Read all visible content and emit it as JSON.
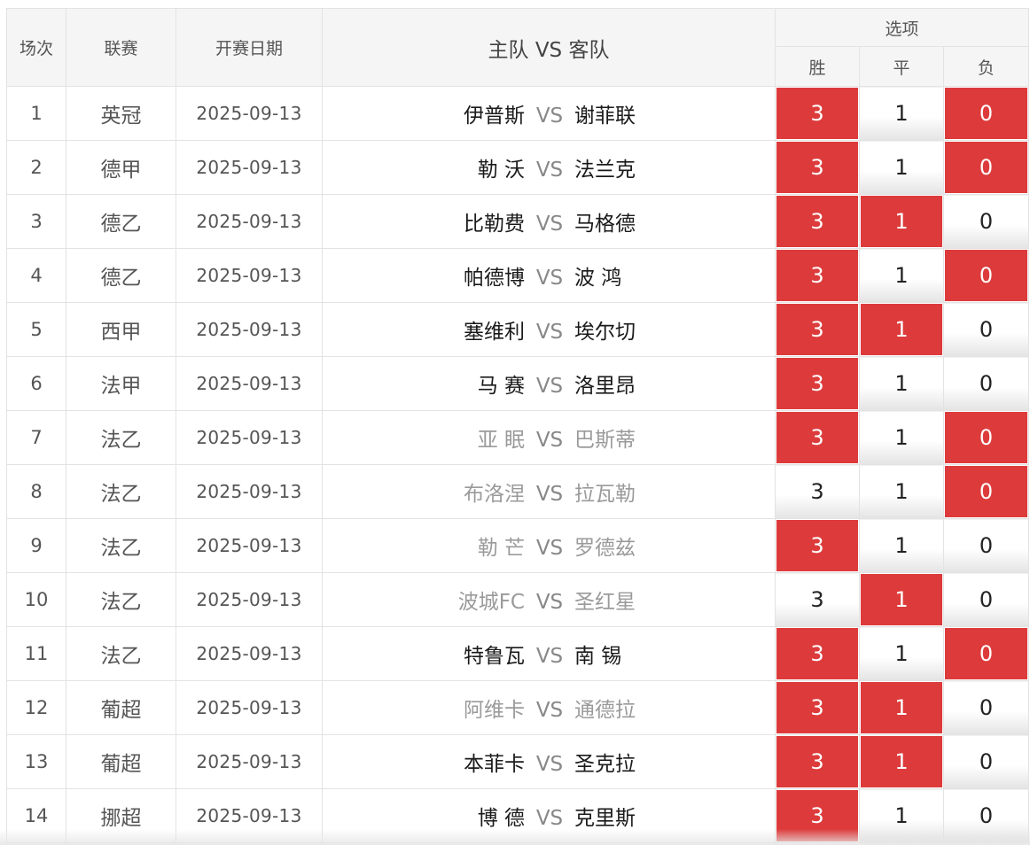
{
  "headers": {
    "num": "场次",
    "league": "联赛",
    "date": "开赛日期",
    "match": "主队 VS 客队",
    "options_group": "选项",
    "win": "胜",
    "draw": "平",
    "lose": "负"
  },
  "colors": {
    "selected": "#dd3b3b",
    "muted_team": "#9a9a9a",
    "dark_team": "#1a1a1a"
  },
  "rows": [
    {
      "num": "1",
      "league": "英冠",
      "date": "2025-09-13",
      "home": "伊普斯",
      "vs": "VS",
      "away": "谢菲联",
      "home_muted": false,
      "away_muted": false,
      "w": "3",
      "d": "1",
      "l": "0",
      "w_on": true,
      "d_on": false,
      "l_on": true
    },
    {
      "num": "2",
      "league": "德甲",
      "date": "2025-09-13",
      "home": "勒 沃",
      "vs": "VS",
      "away": "法兰克",
      "home_muted": false,
      "away_muted": false,
      "w": "3",
      "d": "1",
      "l": "0",
      "w_on": true,
      "d_on": false,
      "l_on": true
    },
    {
      "num": "3",
      "league": "德乙",
      "date": "2025-09-13",
      "home": "比勒费",
      "vs": "VS",
      "away": "马格德",
      "home_muted": false,
      "away_muted": false,
      "w": "3",
      "d": "1",
      "l": "0",
      "w_on": true,
      "d_on": true,
      "l_on": false
    },
    {
      "num": "4",
      "league": "德乙",
      "date": "2025-09-13",
      "home": "帕德博",
      "vs": "VS",
      "away": "波 鸿",
      "home_muted": false,
      "away_muted": false,
      "w": "3",
      "d": "1",
      "l": "0",
      "w_on": true,
      "d_on": false,
      "l_on": true
    },
    {
      "num": "5",
      "league": "西甲",
      "date": "2025-09-13",
      "home": "塞维利",
      "vs": "VS",
      "away": "埃尔切",
      "home_muted": false,
      "away_muted": false,
      "w": "3",
      "d": "1",
      "l": "0",
      "w_on": true,
      "d_on": true,
      "l_on": false
    },
    {
      "num": "6",
      "league": "法甲",
      "date": "2025-09-13",
      "home": "马 赛",
      "vs": "VS",
      "away": "洛里昂",
      "home_muted": false,
      "away_muted": false,
      "w": "3",
      "d": "1",
      "l": "0",
      "w_on": true,
      "d_on": false,
      "l_on": false
    },
    {
      "num": "7",
      "league": "法乙",
      "date": "2025-09-13",
      "home": "亚 眠",
      "vs": "VS",
      "away": "巴斯蒂",
      "home_muted": true,
      "away_muted": true,
      "w": "3",
      "d": "1",
      "l": "0",
      "w_on": true,
      "d_on": false,
      "l_on": true
    },
    {
      "num": "8",
      "league": "法乙",
      "date": "2025-09-13",
      "home": "布洛涅",
      "vs": "VS",
      "away": "拉瓦勒",
      "home_muted": true,
      "away_muted": true,
      "w": "3",
      "d": "1",
      "l": "0",
      "w_on": false,
      "d_on": false,
      "l_on": true
    },
    {
      "num": "9",
      "league": "法乙",
      "date": "2025-09-13",
      "home": "勒 芒",
      "vs": "VS",
      "away": "罗德兹",
      "home_muted": true,
      "away_muted": true,
      "w": "3",
      "d": "1",
      "l": "0",
      "w_on": true,
      "d_on": false,
      "l_on": false
    },
    {
      "num": "10",
      "league": "法乙",
      "date": "2025-09-13",
      "home": "波城FC",
      "vs": "VS",
      "away": "圣红星",
      "home_muted": true,
      "away_muted": true,
      "w": "3",
      "d": "1",
      "l": "0",
      "w_on": false,
      "d_on": true,
      "l_on": false
    },
    {
      "num": "11",
      "league": "法乙",
      "date": "2025-09-13",
      "home": "特鲁瓦",
      "vs": "VS",
      "away": "南 锡",
      "home_muted": false,
      "away_muted": false,
      "w": "3",
      "d": "1",
      "l": "0",
      "w_on": true,
      "d_on": false,
      "l_on": true
    },
    {
      "num": "12",
      "league": "葡超",
      "date": "2025-09-13",
      "home": "阿维卡",
      "vs": "VS",
      "away": "通德拉",
      "home_muted": true,
      "away_muted": true,
      "w": "3",
      "d": "1",
      "l": "0",
      "w_on": true,
      "d_on": true,
      "l_on": false
    },
    {
      "num": "13",
      "league": "葡超",
      "date": "2025-09-13",
      "home": "本菲卡",
      "vs": "VS",
      "away": "圣克拉",
      "home_muted": false,
      "away_muted": false,
      "w": "3",
      "d": "1",
      "l": "0",
      "w_on": true,
      "d_on": true,
      "l_on": false
    },
    {
      "num": "14",
      "league": "挪超",
      "date": "2025-09-13",
      "home": "博 德",
      "vs": "VS",
      "away": "克里斯",
      "home_muted": false,
      "away_muted": false,
      "w": "3",
      "d": "1",
      "l": "0",
      "w_on": true,
      "d_on": false,
      "l_on": false
    }
  ]
}
